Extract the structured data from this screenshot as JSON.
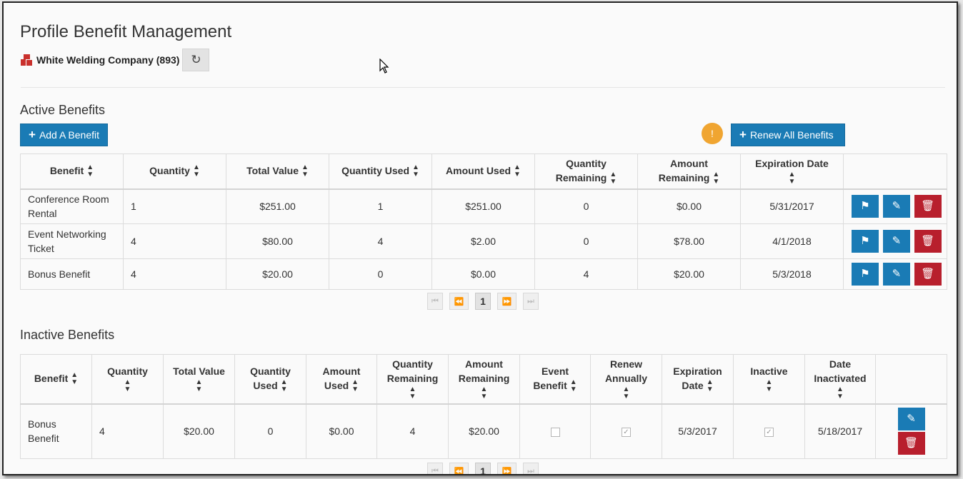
{
  "page_title": "Profile Benefit Management",
  "org": {
    "name": "White Welding Company (893)",
    "refresh_icon": "refresh-icon"
  },
  "colors": {
    "primary": "#1a7bb5",
    "danger": "#b81f2d",
    "badge": "#f0a531"
  },
  "active": {
    "title": "Active Benefits",
    "add_label": "Add A Benefit",
    "renew_label": "Renew All Benefits",
    "badge_text": "!",
    "headers": [
      "Benefit",
      "Quantity",
      "Total Value",
      "Quantity Used",
      "Amount Used",
      "Quantity Remaining",
      "Amount Remaining",
      "Expiration Date"
    ],
    "rows": [
      {
        "benefit": "Conference Room Rental",
        "quantity": "1",
        "total_value": "$251.00",
        "quantity_used": "1",
        "amount_used": "$251.00",
        "quantity_remaining": "0",
        "amount_remaining": "$0.00",
        "expiration": "5/31/2017"
      },
      {
        "benefit": "Event Networking Ticket",
        "quantity": "4",
        "total_value": "$80.00",
        "quantity_used": "4",
        "amount_used": "$2.00",
        "quantity_remaining": "0",
        "amount_remaining": "$78.00",
        "expiration": "4/1/2018"
      },
      {
        "benefit": "Bonus Benefit",
        "quantity": "4",
        "total_value": "$20.00",
        "quantity_used": "0",
        "amount_used": "$0.00",
        "quantity_remaining": "4",
        "amount_remaining": "$20.00",
        "expiration": "5/3/2018"
      }
    ],
    "pager": {
      "current": "1"
    }
  },
  "inactive": {
    "title": "Inactive Benefits",
    "headers": [
      "Benefit",
      "Quantity",
      "Total Value",
      "Quantity Used",
      "Amount Used",
      "Quantity Remaining",
      "Amount Remaining",
      "Event Benefit",
      "Renew Annually",
      "Expiration Date",
      "Inactive",
      "Date Inactivated"
    ],
    "rows": [
      {
        "benefit": "Bonus Benefit",
        "quantity": "4",
        "total_value": "$20.00",
        "quantity_used": "0",
        "amount_used": "$0.00",
        "quantity_remaining": "4",
        "amount_remaining": "$20.00",
        "event_benefit": false,
        "renew_annually": true,
        "expiration": "5/3/2017",
        "inactive": true,
        "date_inactivated": "5/18/2017"
      }
    ],
    "pager": {
      "current": "1"
    }
  }
}
